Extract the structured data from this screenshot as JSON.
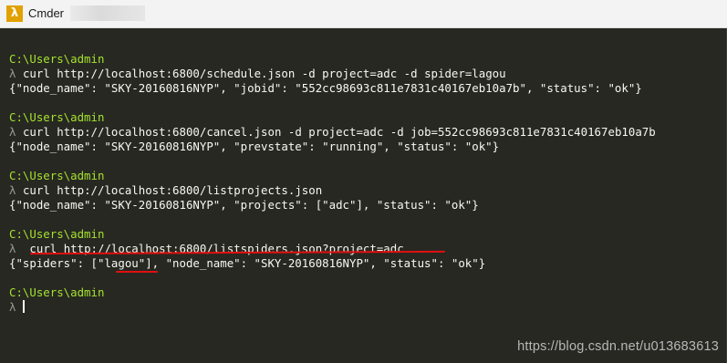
{
  "window": {
    "title": "Cmder",
    "icon": "lambda-icon"
  },
  "terminal": {
    "blocks": [
      {
        "path": "C:\\Users\\admin",
        "lambda": "λ",
        "command": "curl http://localhost:6800/schedule.json -d project=adc -d spider=lagou",
        "output": "{\"node_name\": \"SKY-20160816NYP\", \"jobid\": \"552cc98693c811e7831c40167eb10a7b\", \"status\": \"ok\"}"
      },
      {
        "path": "C:\\Users\\admin",
        "lambda": "λ",
        "command": "curl http://localhost:6800/cancel.json -d project=adc -d job=552cc98693c811e7831c40167eb10a7b",
        "output": "{\"node_name\": \"SKY-20160816NYP\", \"prevstate\": \"running\", \"status\": \"ok\"}"
      },
      {
        "path": "C:\\Users\\admin",
        "lambda": "λ",
        "command": "curl http://localhost:6800/listprojects.json",
        "output": "{\"node_name\": \"SKY-20160816NYP\", \"projects\": [\"adc\"], \"status\": \"ok\"}"
      },
      {
        "path": "C:\\Users\\admin",
        "lambda": "λ",
        "command": " curl http://localhost:6800/listspiders.json?project=adc",
        "output": "{\"spiders\": [\"lagou\"], \"node_name\": \"SKY-20160816NYP\", \"status\": \"ok\"}"
      }
    ],
    "final_prompt": {
      "path": "C:\\Users\\admin",
      "lambda": "λ"
    }
  },
  "annotations": {
    "color": "#e01010"
  },
  "watermark": "https://blog.csdn.net/u013683613",
  "colors": {
    "background": "#272822",
    "path": "#a6e22e",
    "text": "#f8f8f2",
    "lambda": "#9a9a95"
  }
}
